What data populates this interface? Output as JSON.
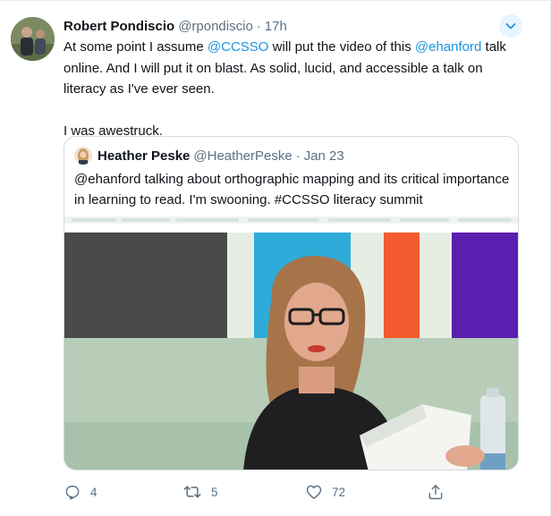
{
  "tweet": {
    "author_name": "Robert Pondiscio",
    "author_handle": "@rpondiscio",
    "separator": "·",
    "time": "17h",
    "text": {
      "l1_a": "At some point I assume ",
      "l1_mention1": "@CCSSO",
      "l1_b": " will put the video of this ",
      "l1_mention2": "@ehanford",
      "l1_c": " talk online. And I will put it on blast. As solid, lucid, and accessible a talk on literacy as I've ever seen.",
      "l2": "I was awestruck."
    }
  },
  "quoted": {
    "author_name": "Heather Peske",
    "author_handle": "@HeatherPeske",
    "separator": "·",
    "date": "Jan 23",
    "text": "@ehanford talking about orthographic mapping and its critical importance in learning to read. I'm swooning. #CCSSO literacy summit"
  },
  "actions": {
    "reply_count": "4",
    "retweet_count": "5",
    "like_count": "72"
  },
  "colors": {
    "link": "#1b95e0",
    "secondary": "#5b7083",
    "border": "#cfd9de",
    "caret_bg": "#e8f5fe"
  },
  "icons": [
    "chevron-down-icon",
    "reply-icon",
    "retweet-icon",
    "like-icon",
    "share-icon"
  ]
}
